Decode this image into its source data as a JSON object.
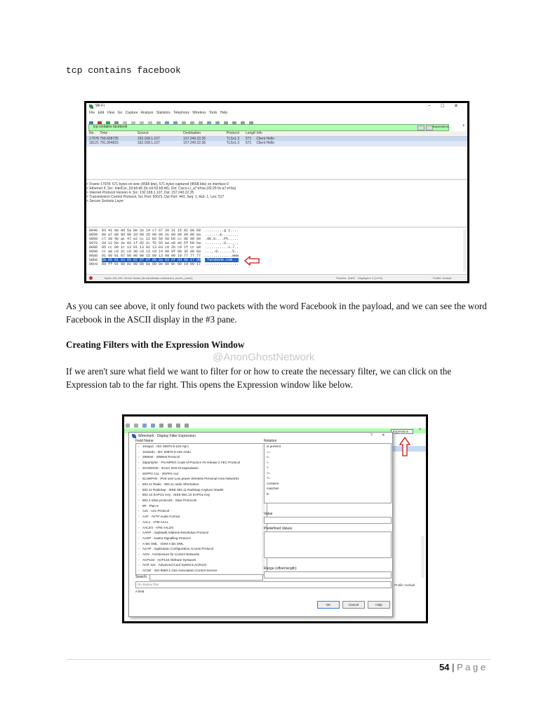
{
  "filter_caption": "tcp contains facebook",
  "screenshot1": {
    "title": "Wi-Fi",
    "menu": [
      "File",
      "Edit",
      "View",
      "Go",
      "Capture",
      "Analyze",
      "Statistics",
      "Telephony",
      "Wireless",
      "Tools",
      "Help"
    ],
    "filter_value": "tcp contains facebook",
    "expression_label": "Expression...",
    "columns": [
      "No.",
      "Time",
      "Source",
      "Destination",
      "Protocol",
      "Length",
      "Info"
    ],
    "packets": [
      [
        "17978",
        "758.668725",
        "192.168.1.107",
        "157.240.22.35",
        "TLSv1.3",
        "571",
        "Client Hello"
      ],
      [
        "18121",
        "791.954815",
        "192.168.1.107",
        "157.240.22.35",
        "TLSv1.3",
        "571",
        "Client Hello"
      ]
    ],
    "details": [
      "Frame 17978: 571 bytes on wire (4568 bits), 571 bytes captured (4568 bits) on interface 0",
      "Ethernet II, Src: IntelCor_53:b5:d6 (0c:e5:53:b5:d6), Dst: Cisco-Li_a7:ef:ba (00:25:9c:a7:ef:ba)",
      "Internet Protocol Version 4, Src: 192.168.1.107, Dst: 157.240.22.35",
      "Transmission Control Protocol, Src Port: 50021, Dst Port: 443, Seq: 1, Ack: 1, Len: 517",
      "Secure Sockets Layer"
    ],
    "hex": [
      {
        "off": "0040",
        "bytes": "03 41 9e 9d 5a 8e 2e 14  c7 67 20 31 15 02 00 00",
        "ascii": ".........g 1...."
      },
      {
        "off": "0050",
        "bytes": "00 a7 00 9d 00 2d 00 26  00 00 2e 00 00 00 00 ea",
        "ascii": ".....-.&........"
      },
      {
        "off": "0060",
        "bytes": "c7 30 4b ac 47 e2 cc 12  b6 50 68 b6 cc d6 00 00",
        "ascii": ".0K.G....Ph....."
      },
      {
        "off": "0070",
        "bytes": "2d 12 be 2e 03 1f d2 2c  f6 55 aa e8 e6 5f b8 ba",
        "ascii": "-......,.U..._.."
      },
      {
        "off": "0080",
        "bytes": "05 cc 00 1c 13 01 13 02  13 03 c0 2b c0 2f cc a9",
        "ascii": "...........+./.."
      },
      {
        "off": "0090",
        "bytes": "cc a8 c0 2c c0 30 c0 13  c0 14 00 9f 00 35 00 0a",
        "ascii": "...,.0.......5.."
      },
      {
        "off": "00a0",
        "bytes": "01 00 01 97 00 00 00 15  00 13 00 00 10 77 77 77",
        "ascii": ".............www"
      },
      {
        "off": "00b0",
        "bytes": "2e 66 61 63 65 62 6f 6f  6b 2e 63 6f 6d 00 17 00",
        "ascii": ".facebook.com..."
      },
      {
        "off": "00c0",
        "bytes": "00 ff 01 00 01 00 00 0a  00 0e 00 0c 00 1d 00 17",
        "ascii": "................"
      }
    ],
    "status_left": "Bytes 114-130: Server Name (tls.handshake.extensions_server_name)",
    "status_mid": "Packets: 21897 · Displayed: 2 (0.0%)",
    "status_right": "Profile: Default"
  },
  "paragraph1": "As you can see above, it only found two packets with the word Facebook in the payload, and we can see the word Facebook in the ASCII display in the #3 pane.",
  "heading": "Creating Filters with the Expression Window",
  "watermark": "@AnonGhostNetwork",
  "paragraph2": "If we aren't sure what field we want to filter for or how to create the necessary filter, we can click on the Expression tab to the far right. This opens the Expression window like below.",
  "screenshot2": {
    "expression_label": "Expression...",
    "profile": "Profile: Default",
    "dialog_title": "Wireshark · Display Filter Expression",
    "help_glyph": "?",
    "close_glyph": "✕",
    "field_name_label": "Field Name",
    "relation_label": "Relation",
    "fields": [
      "104apci · IEC 60870-5-104-Apci",
      "104asdu · IEC 60870-5-104-Asdu",
      "29West · 29West Protocol",
      "2dparityfec · Pro-MPEG Code of Practice #3 release 2 FEC Protocol",
      "3COMXNS · 3Com XNS Encapsulation",
      "3GPP2 A11 · 3GPP2 A11",
      "6LoWPAN · IPv6 over Low power Wireless Personal Area Networks",
      "802.11 Radio · 802.11 radio information",
      "802.11 Radiotap · IEEE 802.11 Radiotap Capture header",
      "802.1X EAPOL Key · IEEE 802.1X EAPOL Key",
      "802.3 Slow protocols · Slow Protocols",
      "9P · Plan 9",
      "A21 · A21 Protocol",
      "AAF · AVTP Audio Format",
      "AAL1 · ATM AAL1",
      "AAL3/4 · ATM AAL3/4",
      "AARP · Appletalk Address Resolution Protocol",
      "AASP · Aastra Signalling Protocol",
      "A-bis OML · GSM A-bis OML",
      "ACAP · Application Configuration Access Protocol",
      "ACN · Architecture for Control Networks",
      "ACP133 · ACP133 Attribute Syntaxes",
      "ACR 122 · Advanced Card Systems ACR122",
      "ACSE · ISO 8650-1 OSI Association Control Service"
    ],
    "relations": [
      "is present",
      "==",
      "!=",
      ">",
      "<",
      ">=",
      "<=",
      "contains",
      "matches",
      "in"
    ],
    "value_label": "Value",
    "predefined_label": "Predefined Values",
    "range_label": "Range (offset:length)",
    "search_label": "Search:",
    "filter_placeholder": "No display filter",
    "status_text": "A field",
    "ok_label": "OK",
    "cancel_label": "Cancel",
    "help_label": "Help"
  },
  "footer": {
    "page_number": "54",
    "separator": "|",
    "page_word": "P a g e"
  },
  "colors": {
    "filter_green": "#afffaf",
    "selected_row": "#c7d8f2",
    "hex_highlight": "#1f5fbf",
    "arrow_red": "#d01010"
  }
}
